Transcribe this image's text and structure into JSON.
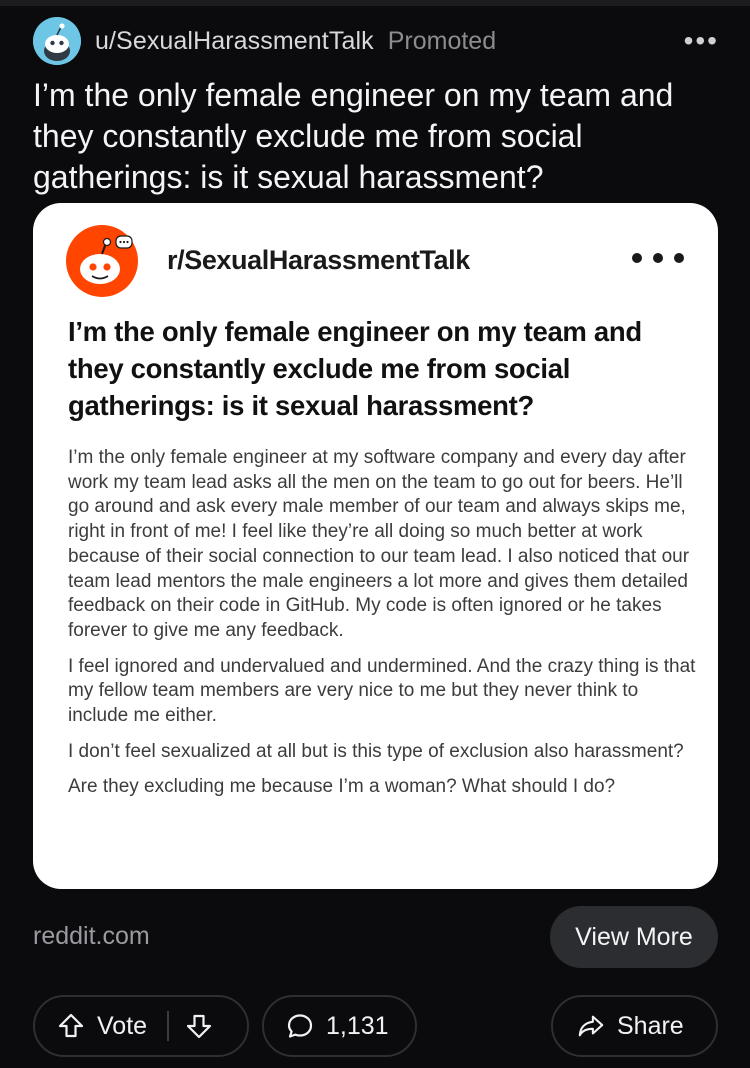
{
  "post": {
    "author": "u/SexualHarassmentTalk",
    "promoted_label": "Promoted",
    "more_label": "•••",
    "title": "I’m the only female engineer on my team and they constantly exclude me from social gatherings: is it sexual harassment?"
  },
  "card": {
    "subreddit": "r/SexualHarassmentTalk",
    "title": "I’m the only female engineer on my team and they constantly exclude me from social gatherings: is it sexual harassment?",
    "paragraphs": [
      "I’m the only female engineer at my software company and every day after work my team lead asks all the men on the team to go out for beers. He’ll go around and ask every male member of our team and always skips me, right in front of me! I feel like they’re all doing so much better at work because of their social connection to our team lead. I also noticed that our team lead mentors the male engineers a lot more and gives them detailed feedback on their code in GitHub. My code is often ignored or he takes forever to give me any feedback.",
      "I feel ignored and undervalued and undermined. And the crazy thing is that my fellow team members are very nice to me but they never think to include me either.",
      "I don’t feel sexualized at all but is this type of exclusion also harassment?",
      "Are they excluding me because I’m a woman? What should I do?"
    ]
  },
  "footer": {
    "domain": "reddit.com",
    "view_more": "View More",
    "vote_label": "Vote",
    "comment_count": "1,131",
    "share_label": "Share"
  },
  "icons": {
    "avatar": "reddit-snoo-avatar-icon",
    "upvote": "arrow-up-icon",
    "downvote": "arrow-down-icon",
    "comment": "speech-bubble-icon",
    "share": "share-arrow-icon"
  },
  "colors": {
    "background": "#0b0b0d",
    "card": "#ffffff",
    "pill": "#2b2d31",
    "snoo_orange": "#ff4500",
    "avatar_blue": "#6ec6e6"
  }
}
